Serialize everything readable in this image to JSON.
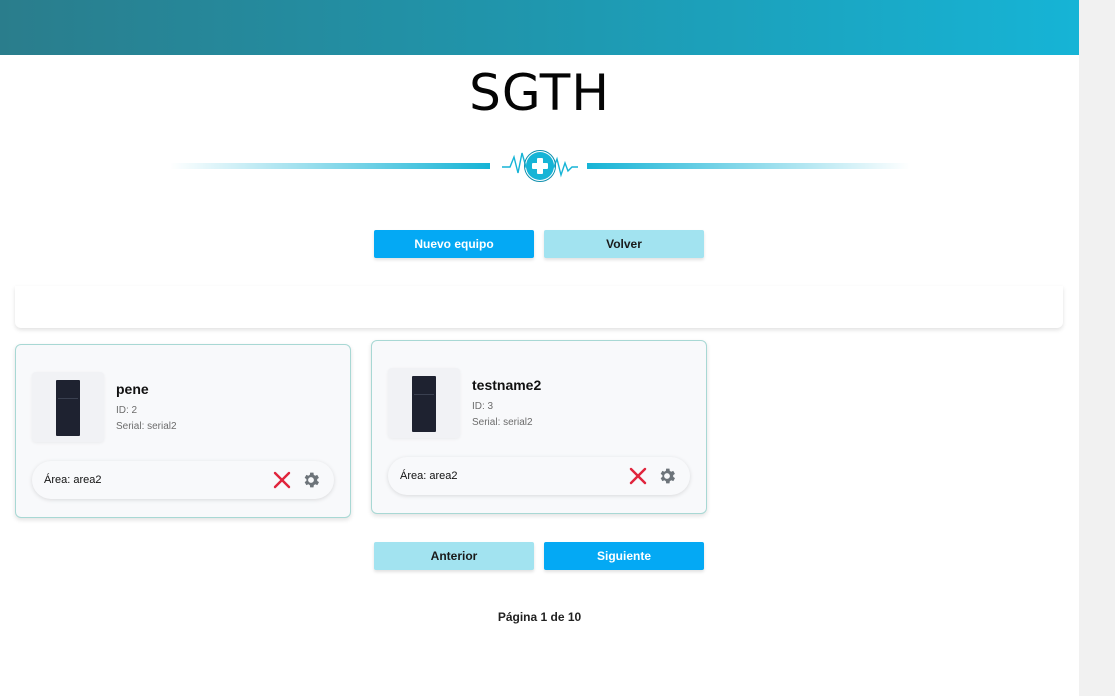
{
  "header": {
    "title": "SGTH"
  },
  "actions": {
    "new_label": "Nuevo equipo",
    "back_label": "Volver"
  },
  "equipment": [
    {
      "name": "pene",
      "id_text": "ID: 2",
      "serial_text": "Serial: serial2",
      "area_text": "Área: area2"
    },
    {
      "name": "testname2",
      "id_text": "ID: 3",
      "serial_text": "Serial: serial2",
      "area_text": "Área: area2"
    }
  ],
  "pager": {
    "prev_label": "Anterior",
    "next_label": "Siguiente",
    "status": "Página 1 de 10"
  },
  "colors": {
    "accent": "#04a9f4",
    "secondary": "#a2e3f0",
    "brand_gradient_start": "#2a7d8c",
    "brand_gradient_end": "#16b4d6",
    "delete": "#e0243c",
    "gear": "#6d747a"
  },
  "icons": {
    "logo": "medical-cross-heartbeat-icon",
    "delete": "close-icon",
    "settings": "gear-icon"
  }
}
